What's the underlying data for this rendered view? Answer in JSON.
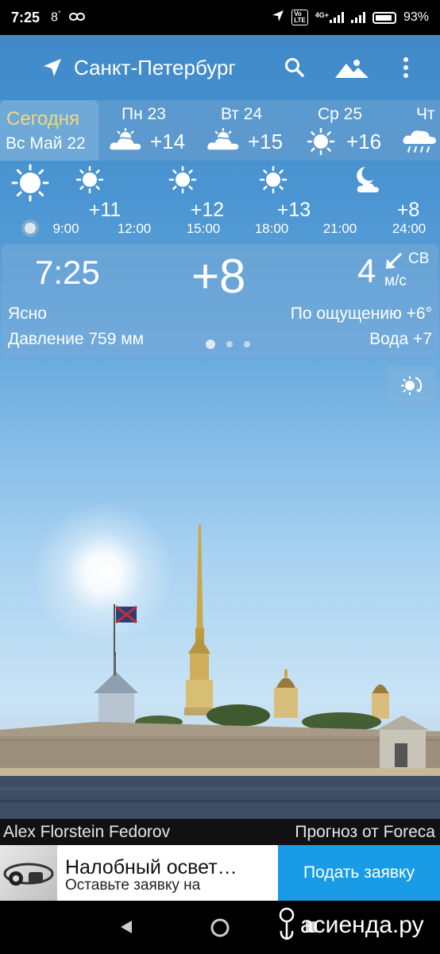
{
  "status_bar": {
    "time": "7:25",
    "temp_indicator": "8",
    "network": "4G+",
    "battery": "93%",
    "battery_level": 0.93
  },
  "header": {
    "city": "Санкт-Петербург",
    "location_icon": "navigation-arrow-icon",
    "search_icon": "search-icon",
    "image_icon": "mountain-image-icon",
    "menu_icon": "more-vert-icon"
  },
  "days": {
    "today": {
      "name": "Сегодня",
      "date": "Вс Май 22"
    },
    "items": [
      {
        "name": "Пн 23",
        "temp": "+14",
        "icon": "partly-cloudy-icon"
      },
      {
        "name": "Вт 24",
        "temp": "+15",
        "icon": "partly-cloudy-icon"
      },
      {
        "name": "Ср 25",
        "temp": "+16",
        "icon": "sun-icon"
      },
      {
        "name": "Чт",
        "temp": "",
        "icon": "rain-cloud-icon"
      }
    ]
  },
  "hourly": {
    "times": [
      "9:00",
      "12:00",
      "15:00",
      "18:00",
      "21:00",
      "24:00"
    ],
    "temps": [
      "+11",
      "+12",
      "+13",
      "+8"
    ]
  },
  "current": {
    "time": "7:25",
    "temp": "+8",
    "wind_speed": "4",
    "wind_dir": "СВ",
    "wind_unit": "м/с",
    "condition": "Ясно",
    "feels_like": "По ощущению +6°",
    "pressure": "Давление 759 мм",
    "water": "Вода +7"
  },
  "credits": {
    "author": "Alex Florstein Fedorov",
    "source": "Прогноз от Foreca"
  },
  "ad": {
    "title": "Налобный освет…",
    "subtitle": "Оставьте заявку на",
    "cta": "Подать заявку"
  },
  "watermark": "асиенда.ру",
  "colors": {
    "accent_today": "#f3d87a",
    "ad_button": "#1a9be6",
    "sky_top": "#3d87c8"
  }
}
